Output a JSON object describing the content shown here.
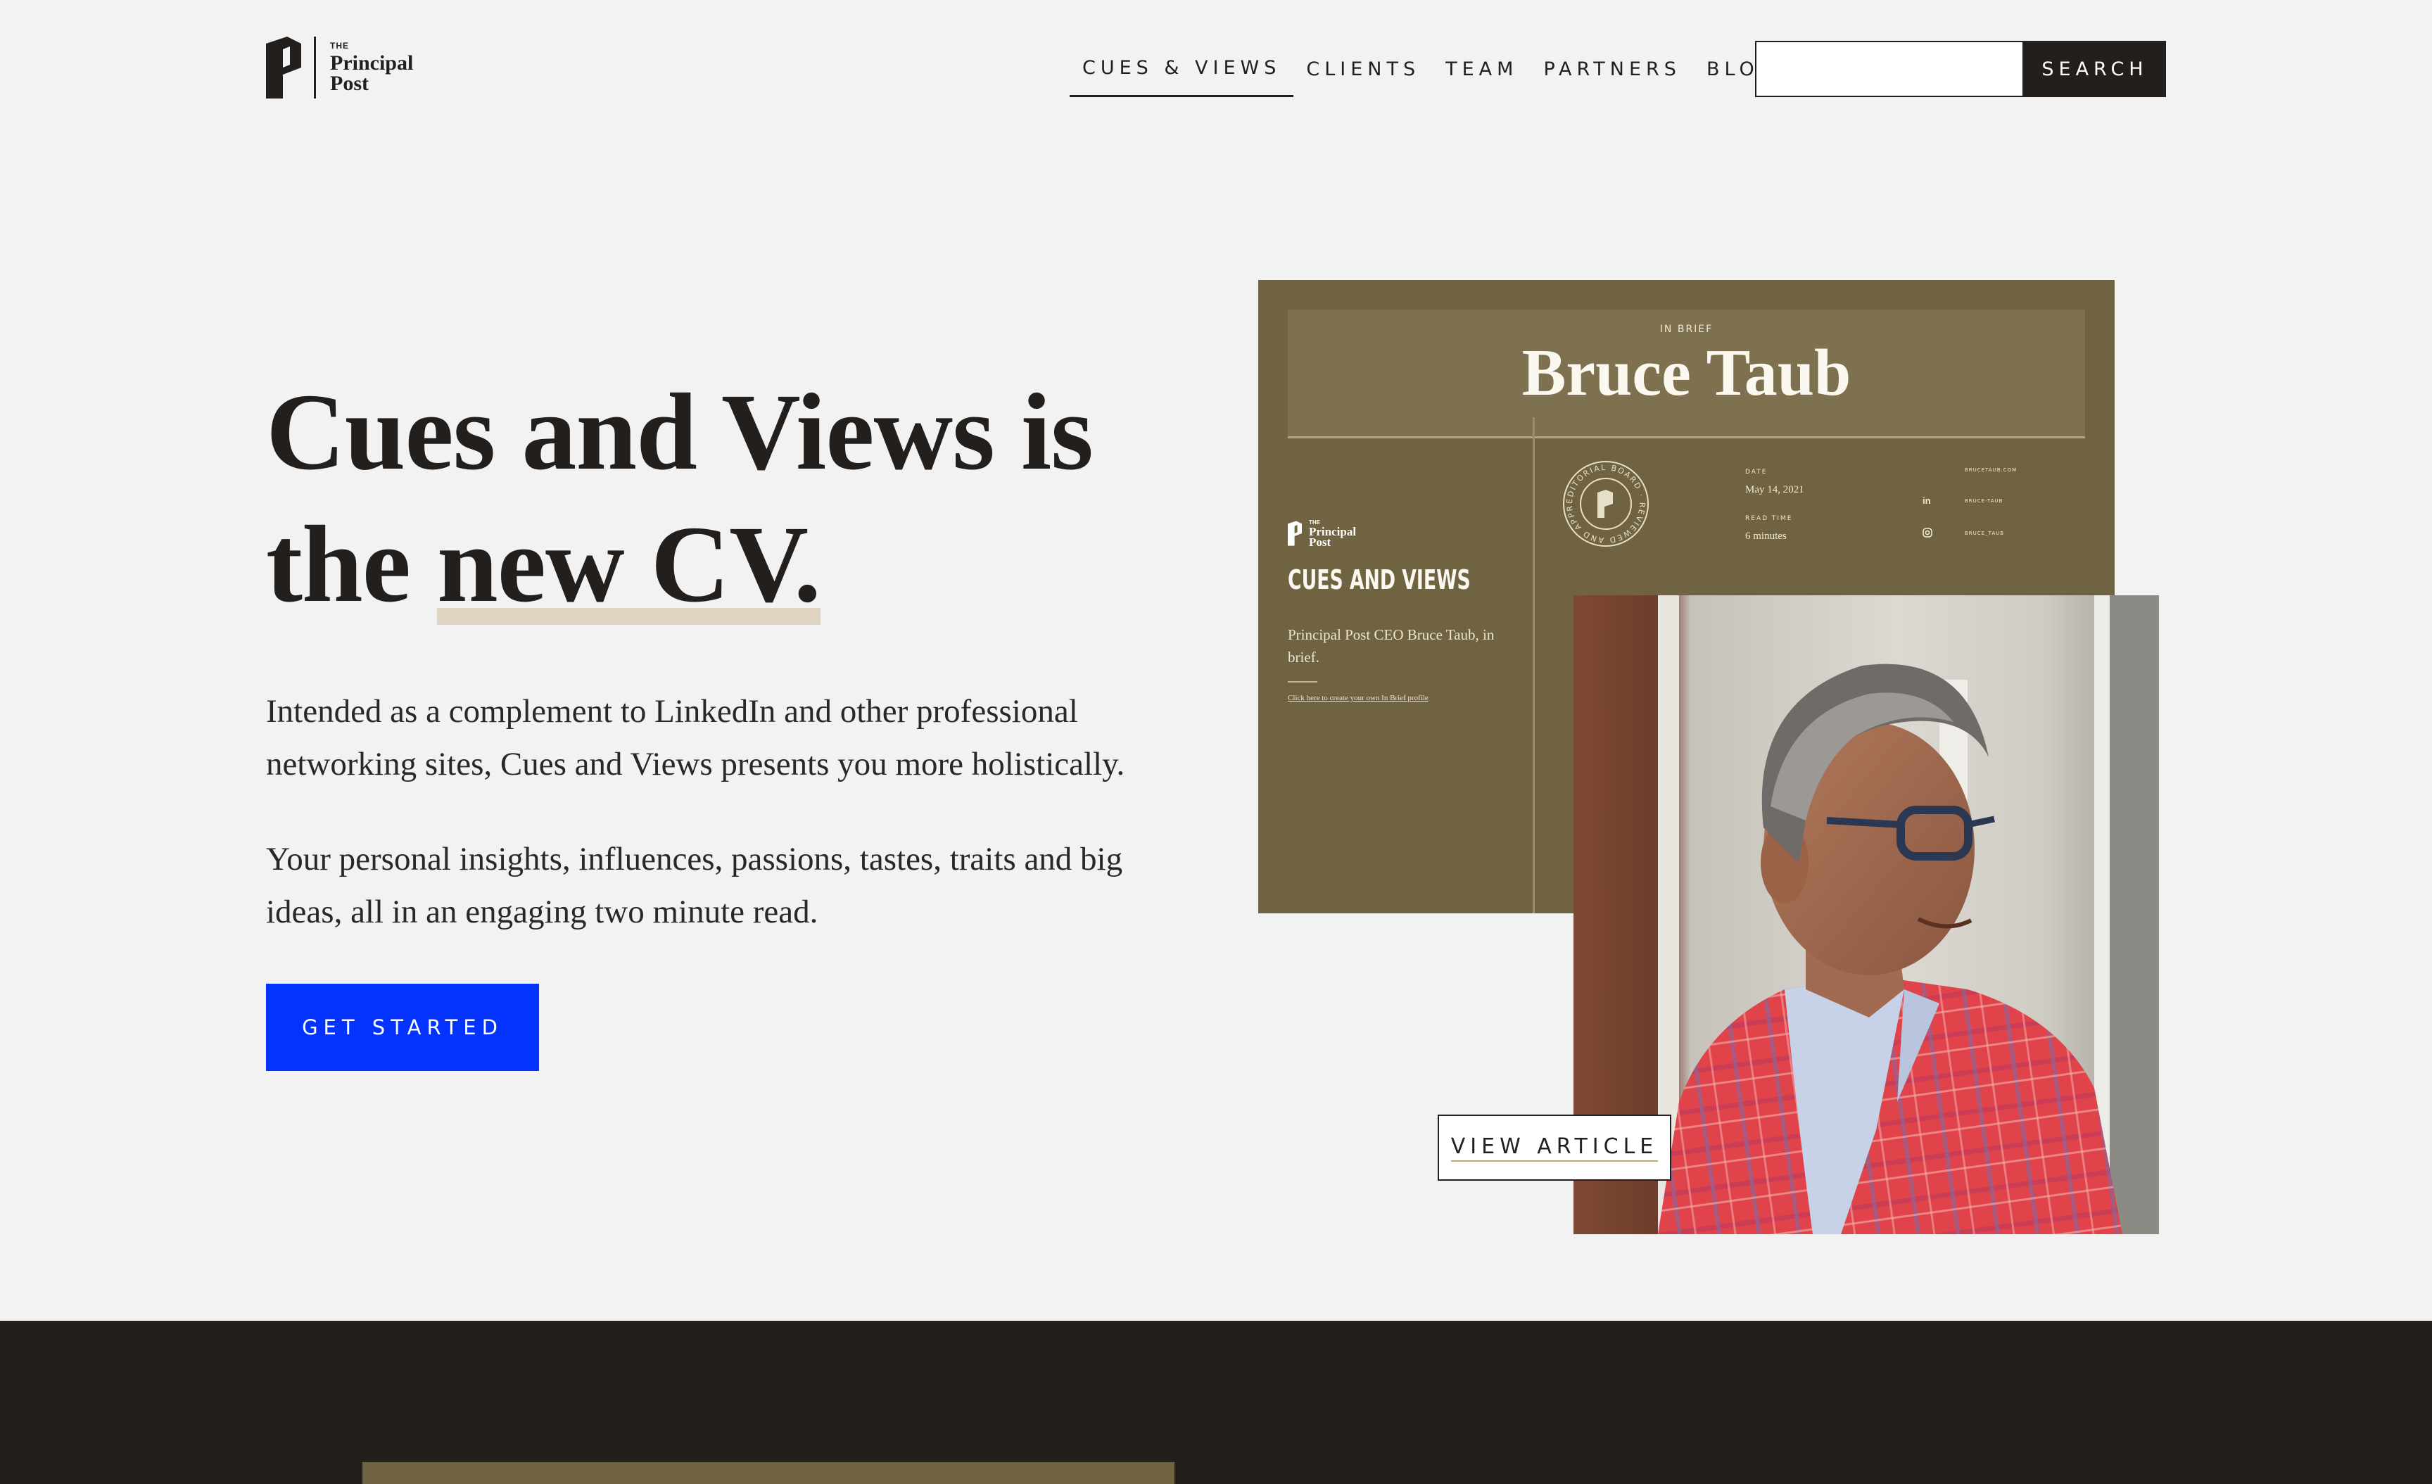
{
  "header": {
    "logo": {
      "the": "THE",
      "line1": "Principal",
      "line2": "Post"
    },
    "nav": [
      {
        "label": "CUES & VIEWS",
        "active": true
      },
      {
        "label": "CLIENTS",
        "active": false
      },
      {
        "label": "TEAM",
        "active": false
      },
      {
        "label": "PARTNERS",
        "active": false
      },
      {
        "label": "BLOG",
        "active": false
      }
    ],
    "search": {
      "value": "",
      "placeholder": "",
      "button_label": "SEARCH"
    }
  },
  "hero": {
    "headline_line1": "Cues and Views is",
    "headline_line2_prefix": "the ",
    "headline_line2_emphasis": "new CV.",
    "paragraph1": "Intended as a complement to LinkedIn and other professional networking sites, Cues and Views presents you more holistically.",
    "paragraph2": "Your personal insights, influences, passions, tastes, traits and big ideas, all in an engaging two minute read.",
    "cta_label": "GET STARTED"
  },
  "preview_card": {
    "kicker": "IN BRIEF",
    "name": "Bruce Taub",
    "logo_the": "THE",
    "logo_line1": "Principal",
    "logo_line2": "Post",
    "title": "CUES AND VIEWS",
    "description": "Principal Post CEO Bruce Taub, in brief.",
    "link_text": "Click here to create your own In Brief profile",
    "date_label": "DATE",
    "date_value": "May 14, 2021",
    "read_label": "READ TIME",
    "read_value": "6 minutes",
    "website": "BRUCETAUB.COM",
    "linkedin": "BRUCE-TAUB",
    "instagram": "BRUCE_TAUB",
    "linkedin_icon": "in",
    "seal_text": "EDITORIAL BOARD · REVIEWED AND APPROVED ·"
  },
  "article_button_label": "VIEW ARTICLE",
  "colors": {
    "background": "#f2f2f2",
    "ink": "#221f1c",
    "cta_blue": "#0432ff",
    "card_olive": "#6f6341",
    "highlight": "#e2d4c2"
  }
}
